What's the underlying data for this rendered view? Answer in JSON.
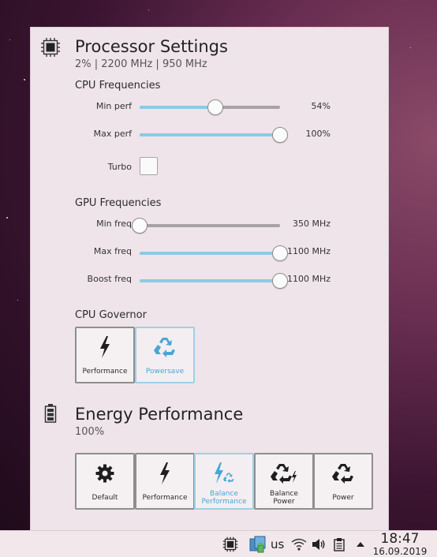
{
  "processor": {
    "title": "Processor Settings",
    "subtitle": "2% | 2200 MHz | 950 MHz",
    "cpu": {
      "heading": "CPU Frequencies",
      "min_perf": {
        "label": "Min perf",
        "value_text": "54%",
        "fraction": 0.54
      },
      "max_perf": {
        "label": "Max perf",
        "value_text": "100%",
        "fraction": 1.0
      },
      "turbo": {
        "label": "Turbo",
        "checked": false
      }
    },
    "gpu": {
      "heading": "GPU Frequencies",
      "min_freq": {
        "label": "Min freq",
        "value_text": "350 MHz",
        "fraction": 0.0
      },
      "max_freq": {
        "label": "Max freq",
        "value_text": "1100 MHz",
        "fraction": 1.0
      },
      "boost_freq": {
        "label": "Boost freq",
        "value_text": "1100 MHz",
        "fraction": 1.0
      }
    },
    "governor": {
      "heading": "CPU Governor",
      "options": [
        {
          "label": "Performance",
          "icon": "lightning-icon",
          "selected": false
        },
        {
          "label": "Powersave",
          "icon": "recycle-icon",
          "selected": true
        }
      ]
    }
  },
  "energy": {
    "title": "Energy Performance",
    "subtitle": "100%",
    "options": [
      {
        "label": "Default",
        "icon": "gear-icon",
        "selected": false
      },
      {
        "label": "Performance",
        "icon": "lightning-icon",
        "selected": false
      },
      {
        "label": "Balance\nPerformance",
        "icon": "lightning-recycle-icon",
        "selected": true
      },
      {
        "label": "Balance\nPower",
        "icon": "recycle-lightning-icon",
        "selected": false
      },
      {
        "label": "Power",
        "icon": "recycle-icon",
        "selected": false
      }
    ]
  },
  "taskbar": {
    "keyboard_layout": "us",
    "time": "18:47",
    "date": "16.09.2019"
  },
  "colors": {
    "accent": "#8ccbe4",
    "active_label": "#4aa6d6",
    "panel_bg": "#efe4e9"
  }
}
